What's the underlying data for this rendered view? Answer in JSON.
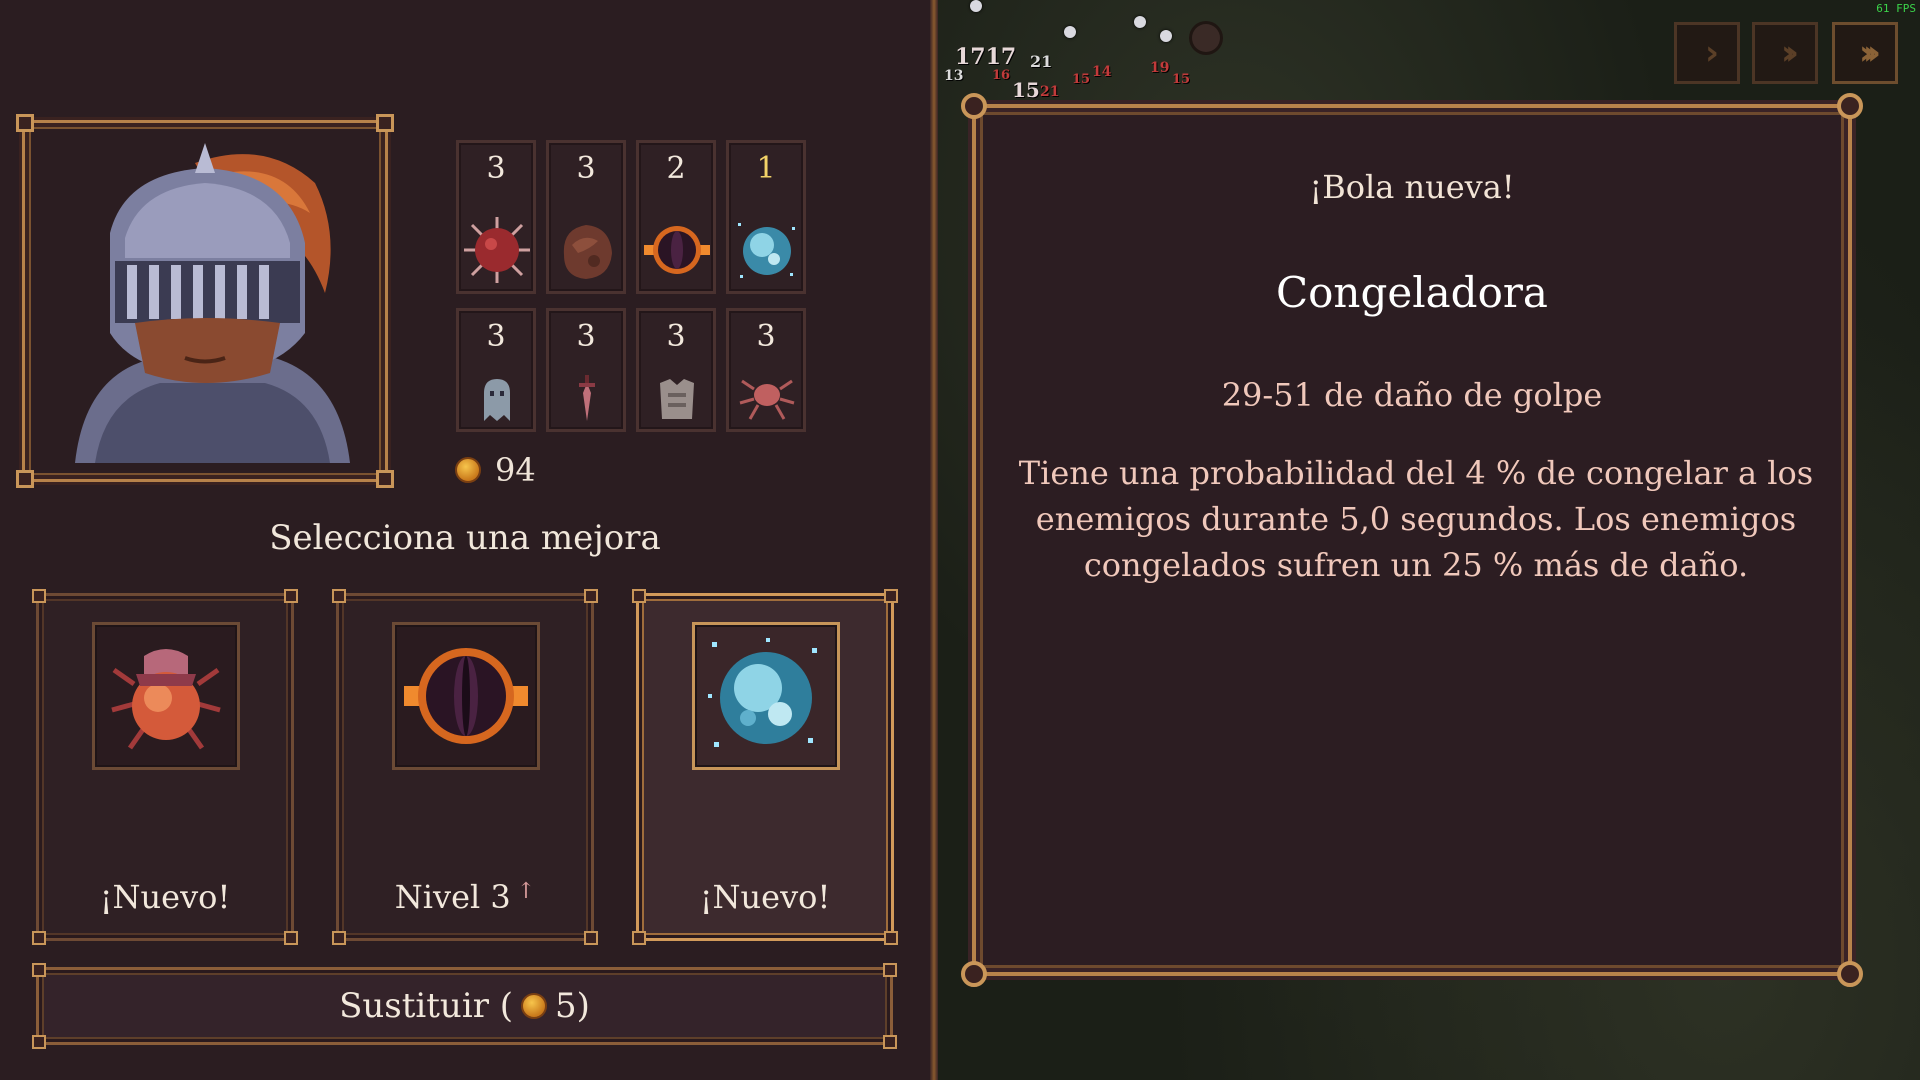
{
  "hud": {
    "fps": "61 FPS"
  },
  "damage_numbers": [
    "1717",
    "21",
    "13",
    "16",
    "15",
    "21",
    "15",
    "14",
    "19",
    "15"
  ],
  "character": {
    "name": "knight-portrait"
  },
  "inventory": {
    "balls": [
      {
        "count": "3",
        "icon": "spiked-ball-icon"
      },
      {
        "count": "3",
        "icon": "rock-ball-icon"
      },
      {
        "count": "2",
        "icon": "dark-portal-ball-icon"
      },
      {
        "count": "1",
        "icon": "frost-ball-icon",
        "highlight": true
      }
    ],
    "passives": [
      {
        "count": "3",
        "icon": "ghost-icon"
      },
      {
        "count": "3",
        "icon": "dagger-icon"
      },
      {
        "count": "3",
        "icon": "armor-icon"
      },
      {
        "count": "3",
        "icon": "spider-icon"
      }
    ],
    "coins": "94"
  },
  "upgrade_select": {
    "title": "Selecciona una mejora",
    "cards": [
      {
        "label": "¡Nuevo!",
        "icon": "beetle-icon",
        "selected": false
      },
      {
        "label": "Nivel 3",
        "icon": "dark-portal-ball-icon",
        "selected": false,
        "upgrade_arrow": "↑"
      },
      {
        "label": "¡Nuevo!",
        "icon": "frost-ball-icon",
        "selected": true
      }
    ],
    "reroll": {
      "label_prefix": "Sustituir (",
      "cost": "5",
      "label_suffix": ")"
    }
  },
  "speed_controls": [
    {
      "label": "›",
      "name": "speed-1x"
    },
    {
      "label": "››",
      "name": "speed-2x"
    },
    {
      "label": "›››",
      "name": "speed-3x"
    }
  ],
  "detail": {
    "subtitle": "¡Bola nueva!",
    "title": "Congeladora",
    "stat": "29-51 de daño de golpe",
    "description": "Tiene una probabilidad del 4 % de congelar a los enemigos durante 5,0 segundos. Los enemigos congelados sufren un 25 % más de daño."
  },
  "colors": {
    "accent_gold": "#b8834b",
    "panel_bg": "#2c1d22",
    "new_count": "#f3d368"
  }
}
